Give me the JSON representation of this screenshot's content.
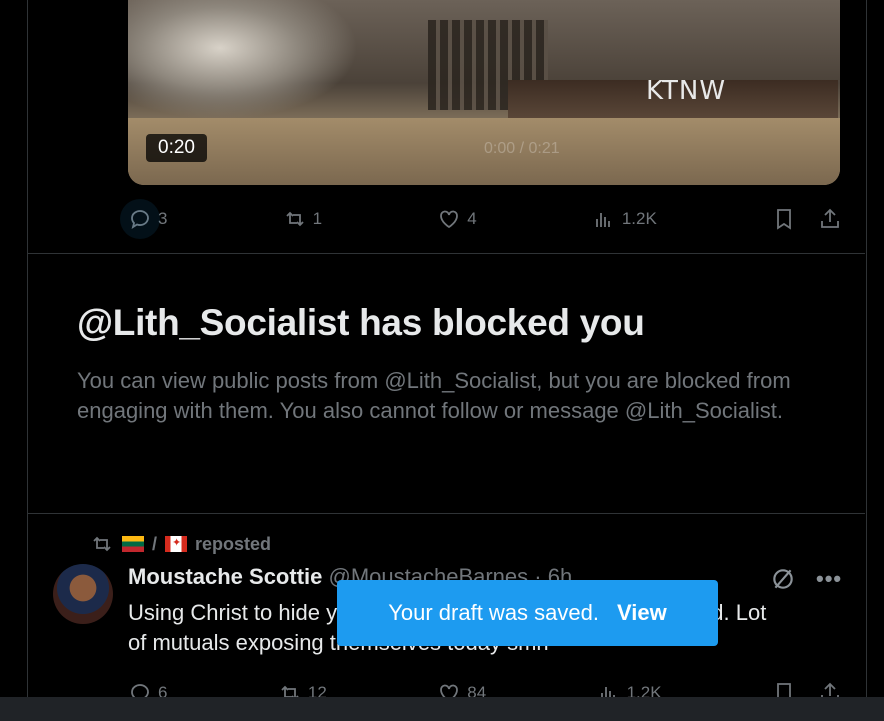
{
  "video": {
    "duration": "0:20",
    "channel_logo": "KTNW",
    "overlay_ghost": "0:00 / 0:21"
  },
  "post1_actions": {
    "replies": "3",
    "reposts": "1",
    "likes": "4",
    "views": "1.2K",
    "icons": [
      "reply-icon",
      "repost-icon",
      "like-icon",
      "views-icon",
      "bookmark-icon",
      "share-icon"
    ]
  },
  "blocked": {
    "title": "@Lith_Socialist has blocked you",
    "description": "You can view public posts from @Lith_Socialist, but you are blocked from engaging with them. You also cannot follow or message @Lith_Socialist."
  },
  "post2": {
    "repost_label": "reposted",
    "repost_sep": "/",
    "author_name": "Moustache Scottie",
    "author_handle": "@MoustacheBarnes · 6h",
    "text": "Using Christ to hide your bigotry makes you sound braindead. Lot of mutuals exposing themselves today smh",
    "replies": "6",
    "reposts": "12",
    "likes": "84",
    "views": "1.2K"
  },
  "toast": {
    "message": "Your draft was saved.",
    "action": "View"
  },
  "colors": {
    "background": "#000000",
    "accent": "#1d9bf0",
    "muted": "#71767b",
    "border": "#2f3336"
  }
}
